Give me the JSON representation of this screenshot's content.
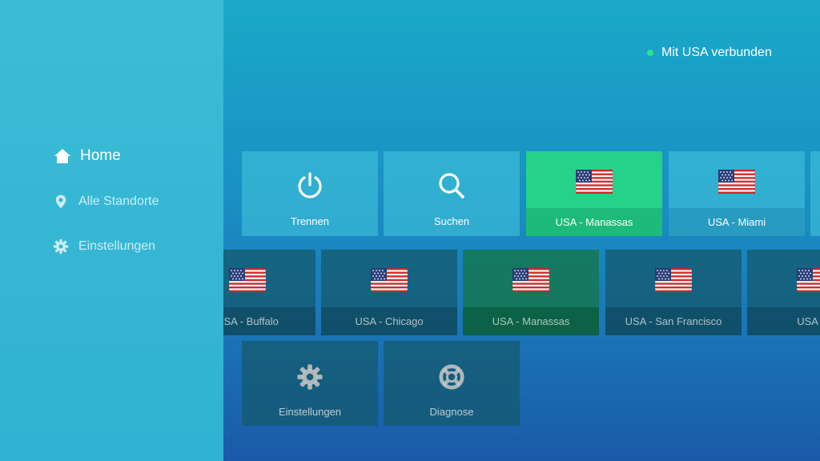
{
  "sidebar": {
    "items": [
      {
        "label": "Home",
        "icon": "home-icon"
      },
      {
        "label": "Alle Standorte",
        "icon": "location-pin-icon"
      },
      {
        "label": "Einstellungen",
        "icon": "gear-icon"
      }
    ]
  },
  "status": {
    "text": "Mit USA verbunden",
    "color": "#2ee58a"
  },
  "row1": [
    {
      "label": "Trennen",
      "icon": "power-icon"
    },
    {
      "label": "Suchen",
      "icon": "search-icon"
    },
    {
      "label": "USA - Manassas",
      "icon": "us-flag-icon"
    },
    {
      "label": "USA - Miami",
      "icon": "us-flag-icon"
    }
  ],
  "row2": [
    {
      "label": "USA - Buffalo",
      "icon": "us-flag-icon"
    },
    {
      "label": "USA - Chicago",
      "icon": "us-flag-icon"
    },
    {
      "label": "USA - Manassas",
      "icon": "us-flag-icon"
    },
    {
      "label": "USA - San Francisco",
      "icon": "us-flag-icon"
    },
    {
      "label": "USA - A",
      "icon": "us-flag-icon"
    }
  ],
  "row3": [
    {
      "label": "Einstellungen",
      "icon": "gear-icon"
    },
    {
      "label": "Diagnose",
      "icon": "lifebuoy-icon"
    }
  ],
  "colors": {
    "selected": "#26d28a",
    "accent": "#2ee58a"
  }
}
